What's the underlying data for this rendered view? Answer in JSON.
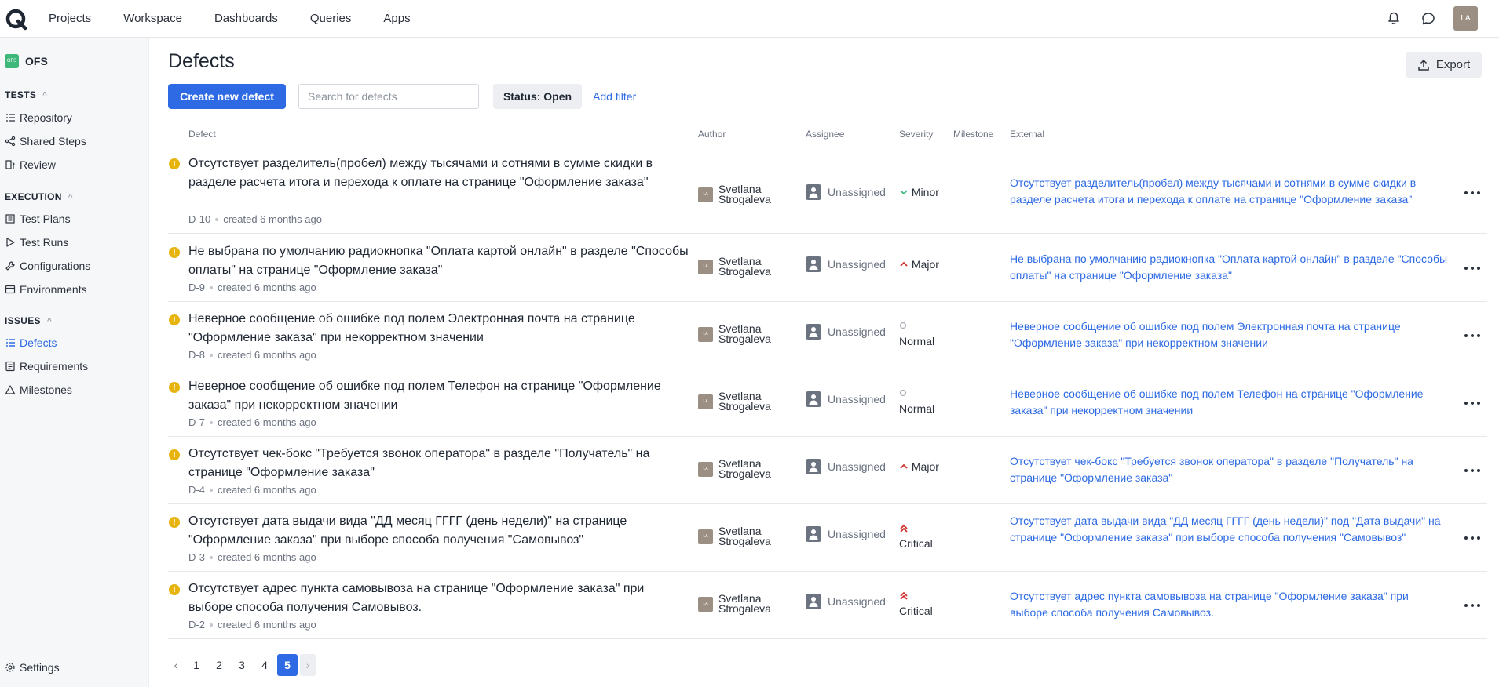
{
  "topnav": {
    "items": [
      "Projects",
      "Workspace",
      "Dashboards",
      "Queries",
      "Apps"
    ],
    "avatar": "LA"
  },
  "sidebar": {
    "project_badge": "OFS",
    "project_name": "OFS",
    "sections": {
      "tests": "TESTS",
      "execution": "EXECUTION",
      "issues": "ISSUES"
    },
    "tests_items": [
      "Repository",
      "Shared Steps",
      "Review"
    ],
    "execution_items": [
      "Test Plans",
      "Test Runs",
      "Configurations",
      "Environments"
    ],
    "issues_items": [
      "Defects",
      "Requirements",
      "Milestones"
    ],
    "settings": "Settings"
  },
  "page": {
    "title": "Defects",
    "export_label": "Export",
    "create_label": "Create new defect",
    "search_placeholder": "Search for defects",
    "status_filter": "Status: Open",
    "add_filter": "Add filter"
  },
  "table": {
    "headers": [
      "Defect",
      "Author",
      "Assignee",
      "Severity",
      "Milestone",
      "External"
    ],
    "rows": [
      {
        "title": "Отсутствует разделитель(пробел) между тысячами и сотнями в сумме скидки в разделе расчета итога и перехода к оплате на странице \"Оформление заказа\"",
        "id": "D-10",
        "created": "created 6 months ago",
        "author_line1": "Svetlana",
        "author_line2": "Strogaleva",
        "author_initials": "LA",
        "assignee": "Unassigned",
        "severity": "Minor",
        "severity_icon": "chevron-down-icon",
        "external": "Отсутствует разделитель(пробел) между тысячами и сотнями в сумме скидки в разделе расчета итога и перехода к оплате на странице \"Оформление заказа\""
      },
      {
        "title": "Не выбрана по умолчанию радиокнопка \"Оплата картой онлайн\" в разделе \"Способы оплаты\" на странице \"Оформление заказа\"",
        "id": "D-9",
        "created": "created 6 months ago",
        "author_line1": "Svetlana",
        "author_line2": "Strogaleva",
        "author_initials": "LA",
        "assignee": "Unassigned",
        "severity": "Major",
        "severity_icon": "chevron-up-icon",
        "external": "Не выбрана по умолчанию радиокнопка \"Оплата картой онлайн\" в разделе \"Способы оплаты\" на странице \"Оформление заказа\""
      },
      {
        "title": "Неверное сообщение об ошибке под полем Электронная почта на странице \"Оформление заказа\" при некорректном значении",
        "id": "D-8",
        "created": "created 6 months ago",
        "author_line1": "Svetlana",
        "author_line2": "Strogaleva",
        "author_initials": "LA",
        "assignee": "Unassigned",
        "severity": "Normal",
        "severity_icon": "circle-icon",
        "external": "Неверное сообщение об ошибке под полем Электронная почта на странице \"Оформление заказа\" при некорректном значении"
      },
      {
        "title": "Неверное сообщение об ошибке под полем Телефон на странице \"Оформление заказа\" при некорректном значении",
        "id": "D-7",
        "created": "created 6 months ago",
        "author_line1": "Svetlana",
        "author_line2": "Strogaleva",
        "author_initials": "LA",
        "assignee": "Unassigned",
        "severity": "Normal",
        "severity_icon": "circle-icon",
        "external": "Неверное сообщение об ошибке под полем Телефон на странице \"Оформление заказа\" при некорректном значении"
      },
      {
        "title": "Отсутствует чек-бокс \"Требуется звонок оператора\" в разделе \"Получатель\" на странице \"Оформление заказа\"",
        "id": "D-4",
        "created": "created 6 months ago",
        "author_line1": "Svetlana",
        "author_line2": "Strogaleva",
        "author_initials": "LA",
        "assignee": "Unassigned",
        "severity": "Major",
        "severity_icon": "chevron-up-icon",
        "external": "Отсутствует чек-бокс \"Требуется звонок оператора\" в разделе \"Получатель\" на странице \"Оформление заказа\""
      },
      {
        "title": "Отсутствует дата выдачи вида \"ДД месяц ГГГГ (день недели)\" на странице \"Оформление заказа\" при выборе способа получения \"Самовывоз\"",
        "id": "D-3",
        "created": "created 6 months ago",
        "author_line1": "Svetlana",
        "author_line2": "Strogaleva",
        "author_initials": "LA",
        "assignee": "Unassigned",
        "severity": "Critical",
        "severity_icon": "double-chevron-up-icon",
        "external": "Отсутствует дата выдачи вида \"ДД месяц ГГГГ (день недели)\" под \"Дата выдачи\" на странице \"Оформление заказа\" при выборе способа получения \"Самовывоз\""
      },
      {
        "title": "Отсутствует адрес пункта самовывоза на странице \"Оформление заказа\" при выборе способа получения Самовывоз.",
        "id": "D-2",
        "created": "created 6 months ago",
        "author_line1": "Svetlana",
        "author_line2": "Strogaleva",
        "author_initials": "LA",
        "assignee": "Unassigned",
        "severity": "Critical",
        "severity_icon": "double-chevron-up-icon",
        "external": "Отсутствует адрес пункта самовывоза на странице \"Оформление заказа\" при выборе способа получения Самовывоз."
      }
    ]
  },
  "pagination": {
    "prev": "‹",
    "pages": [
      "1",
      "2",
      "3",
      "4",
      "5"
    ],
    "current": "5",
    "next": "›"
  },
  "colors": {
    "accent": "#2d6ae3",
    "warning": "#e6b40c",
    "minor": "#3db87a",
    "major": "#d0312d"
  }
}
